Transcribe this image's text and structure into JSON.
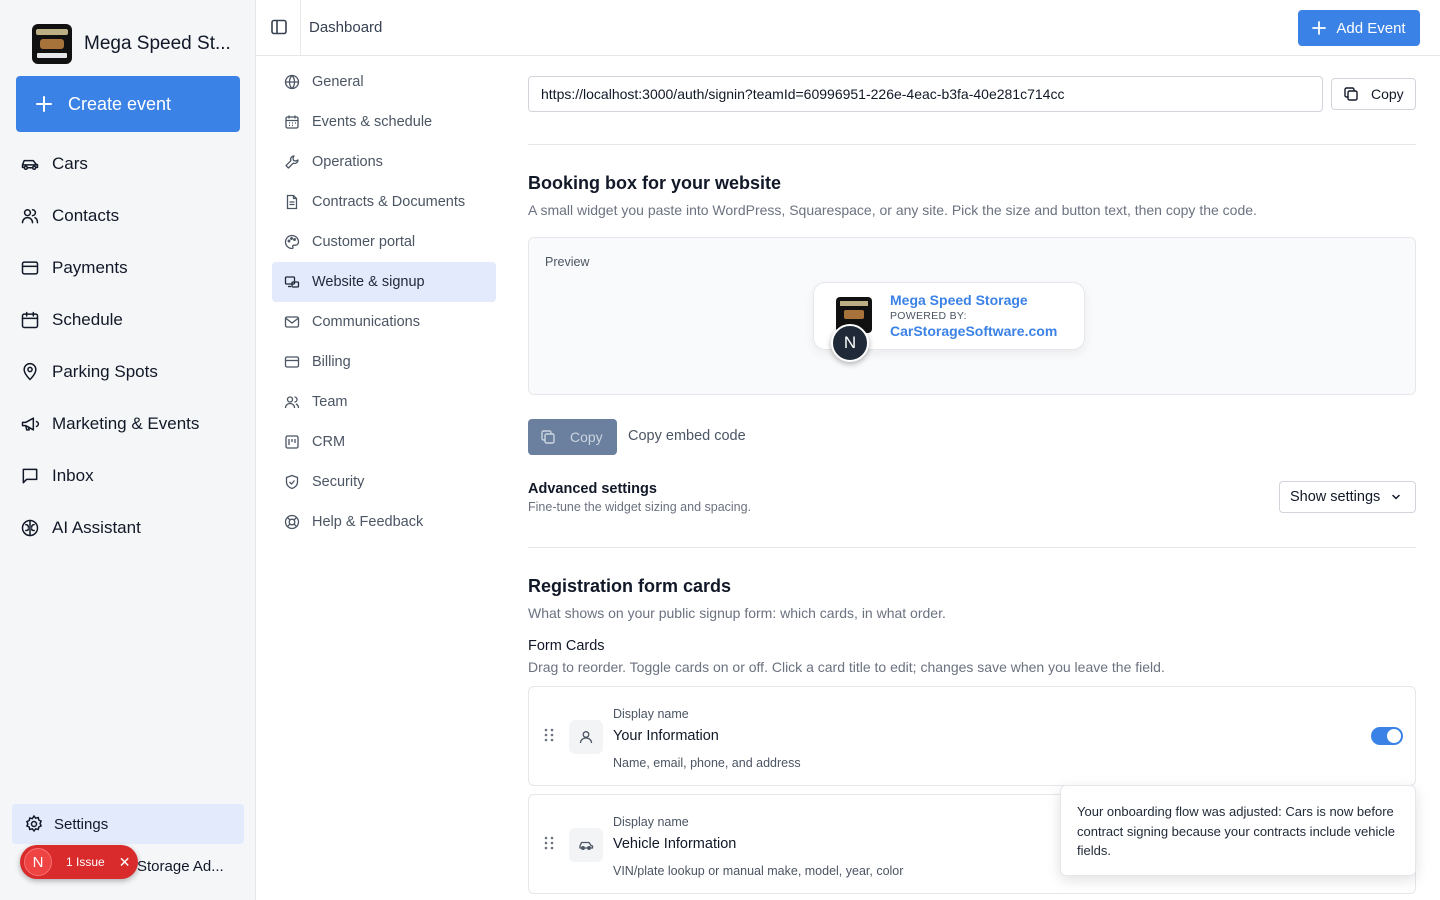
{
  "sidebar": {
    "brand_name": "Mega Speed St...",
    "create_label": "Create event",
    "items": [
      {
        "label": "Cars",
        "icon": "car-icon"
      },
      {
        "label": "Contacts",
        "icon": "users-icon"
      },
      {
        "label": "Payments",
        "icon": "credit-card-icon"
      },
      {
        "label": "Schedule",
        "icon": "calendar-icon"
      },
      {
        "label": "Parking Spots",
        "icon": "map-pin-icon"
      },
      {
        "label": "Marketing & Events",
        "icon": "megaphone-icon"
      },
      {
        "label": "Inbox",
        "icon": "message-square-icon"
      },
      {
        "label": "AI Assistant",
        "icon": "brain-icon"
      }
    ],
    "settings_label": "Settings",
    "account_text": "Storage Ad...",
    "issue": {
      "avatar": "N",
      "label": "1 Issue",
      "close": "✕"
    }
  },
  "topbar": {
    "breadcrumb": "Dashboard",
    "add_event_label": "Add Event"
  },
  "subnav": {
    "items": [
      {
        "label": "General",
        "icon": "globe-icon"
      },
      {
        "label": "Events & schedule",
        "icon": "calendar-icon"
      },
      {
        "label": "Operations",
        "icon": "wrench-icon"
      },
      {
        "label": "Contracts & Documents",
        "icon": "file-text-icon"
      },
      {
        "label": "Customer portal",
        "icon": "palette-icon"
      },
      {
        "label": "Website & signup",
        "icon": "link-icon"
      },
      {
        "label": "Communications",
        "icon": "mail-icon"
      },
      {
        "label": "Billing",
        "icon": "credit-card-icon"
      },
      {
        "label": "Team",
        "icon": "users-icon"
      },
      {
        "label": "CRM",
        "icon": "crm-icon"
      },
      {
        "label": "Security",
        "icon": "shield-icon"
      },
      {
        "label": "Help & Feedback",
        "icon": "life-buoy-icon"
      }
    ],
    "active": "Website & signup"
  },
  "main": {
    "signin_url": "https://localhost:3000/auth/signin?teamId=60996951-226e-4eac-b3fa-40e281c714cc",
    "copy_label": "Copy",
    "booking": {
      "title": "Booking box for your website",
      "description": "A small widget you paste into WordPress, Squarespace, or any site. Pick the size and button text, then copy the code.",
      "preview_label": "Preview",
      "widget_title": "Mega Speed Storage",
      "widget_powered": "POWERED BY:",
      "widget_site": "CarStorageSoftware.com",
      "widget_avatar": "N",
      "copy_label": "Copy",
      "embed_label": "Copy embed code"
    },
    "advanced": {
      "title": "Advanced settings",
      "description": "Fine-tune the widget sizing and spacing.",
      "button_label": "Show settings"
    },
    "registration": {
      "title": "Registration form cards",
      "description": "What shows on your public signup form: which cards, in what order.",
      "form_cards_label": "Form Cards",
      "form_cards_desc": "Drag to reorder. Toggle cards on or off. Click a card title to edit; changes save when you leave the field.",
      "cards": [
        {
          "small_label": "Display name",
          "title": "Your Information",
          "desc": "Name, email, phone, and address",
          "icon": "user-icon",
          "enabled": true
        },
        {
          "small_label": "Display name",
          "title": "Vehicle Information",
          "desc": "VIN/plate lookup or manual make, model, year, color",
          "icon": "car-icon",
          "enabled": true
        }
      ]
    }
  },
  "toast": {
    "message": "Your onboarding flow was adjusted: Cars is now before contract signing because your contracts include vehicle fields."
  },
  "colors": {
    "accent": "#3b82e6",
    "active_bg": "#e3eafb",
    "issue_red": "#d92b2b"
  }
}
